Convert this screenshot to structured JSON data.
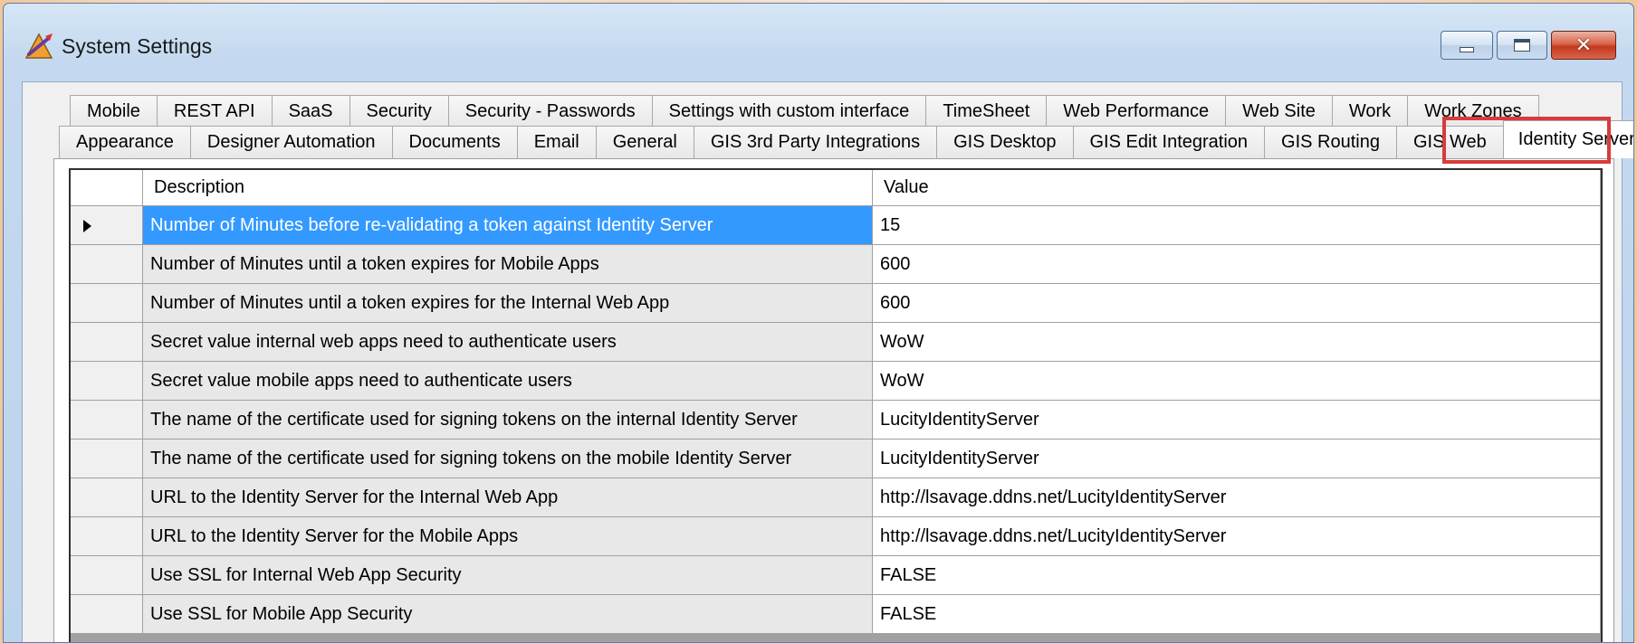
{
  "window": {
    "title": "System Settings",
    "buttons": {
      "minimize": "minimize-icon",
      "maximize": "maximize-icon",
      "close": "close-icon"
    }
  },
  "tabs": {
    "back_row": [
      "Mobile",
      "REST API",
      "SaaS",
      "Security",
      "Security - Passwords",
      "Settings with custom interface",
      "TimeSheet",
      "Web Performance",
      "Web Site",
      "Work",
      "Work Zones"
    ],
    "front_row": [
      "Appearance",
      "Designer Automation",
      "Documents",
      "Email",
      "General",
      "GIS 3rd Party Integrations",
      "GIS Desktop",
      "GIS Edit Integration",
      "GIS Routing",
      "GIS Web"
    ],
    "selected": "Identity Server",
    "highlight_color": "#d83b3b"
  },
  "grid": {
    "columns": [
      "Description",
      "Value"
    ],
    "current_row": 0,
    "selection_color": "#3399ff",
    "rows": [
      {
        "description": "Number of Minutes before re-validating a token against Identity Server",
        "value": "15"
      },
      {
        "description": "Number of Minutes until a token expires for Mobile Apps",
        "value": "600"
      },
      {
        "description": "Number of Minutes until a token expires for the Internal Web App",
        "value": "600"
      },
      {
        "description": "Secret value internal web apps need to authenticate users",
        "value": "WoW"
      },
      {
        "description": "Secret value mobile apps need to authenticate users",
        "value": "WoW"
      },
      {
        "description": "The name of the certificate used for signing tokens on the internal Identity Server",
        "value": "LucityIdentityServer"
      },
      {
        "description": "The name of the certificate used for signing tokens on the mobile Identity Server",
        "value": "LucityIdentityServer"
      },
      {
        "description": "URL to the Identity Server for the Internal Web App",
        "value": "http://lsavage.ddns.net/LucityIdentityServer"
      },
      {
        "description": "URL to the Identity Server for the Mobile Apps",
        "value": "http://lsavage.ddns.net/LucityIdentityServer"
      },
      {
        "description": "Use SSL for Internal Web App Security",
        "value": "FALSE"
      },
      {
        "description": "Use SSL for Mobile App Security",
        "value": "FALSE"
      }
    ]
  }
}
